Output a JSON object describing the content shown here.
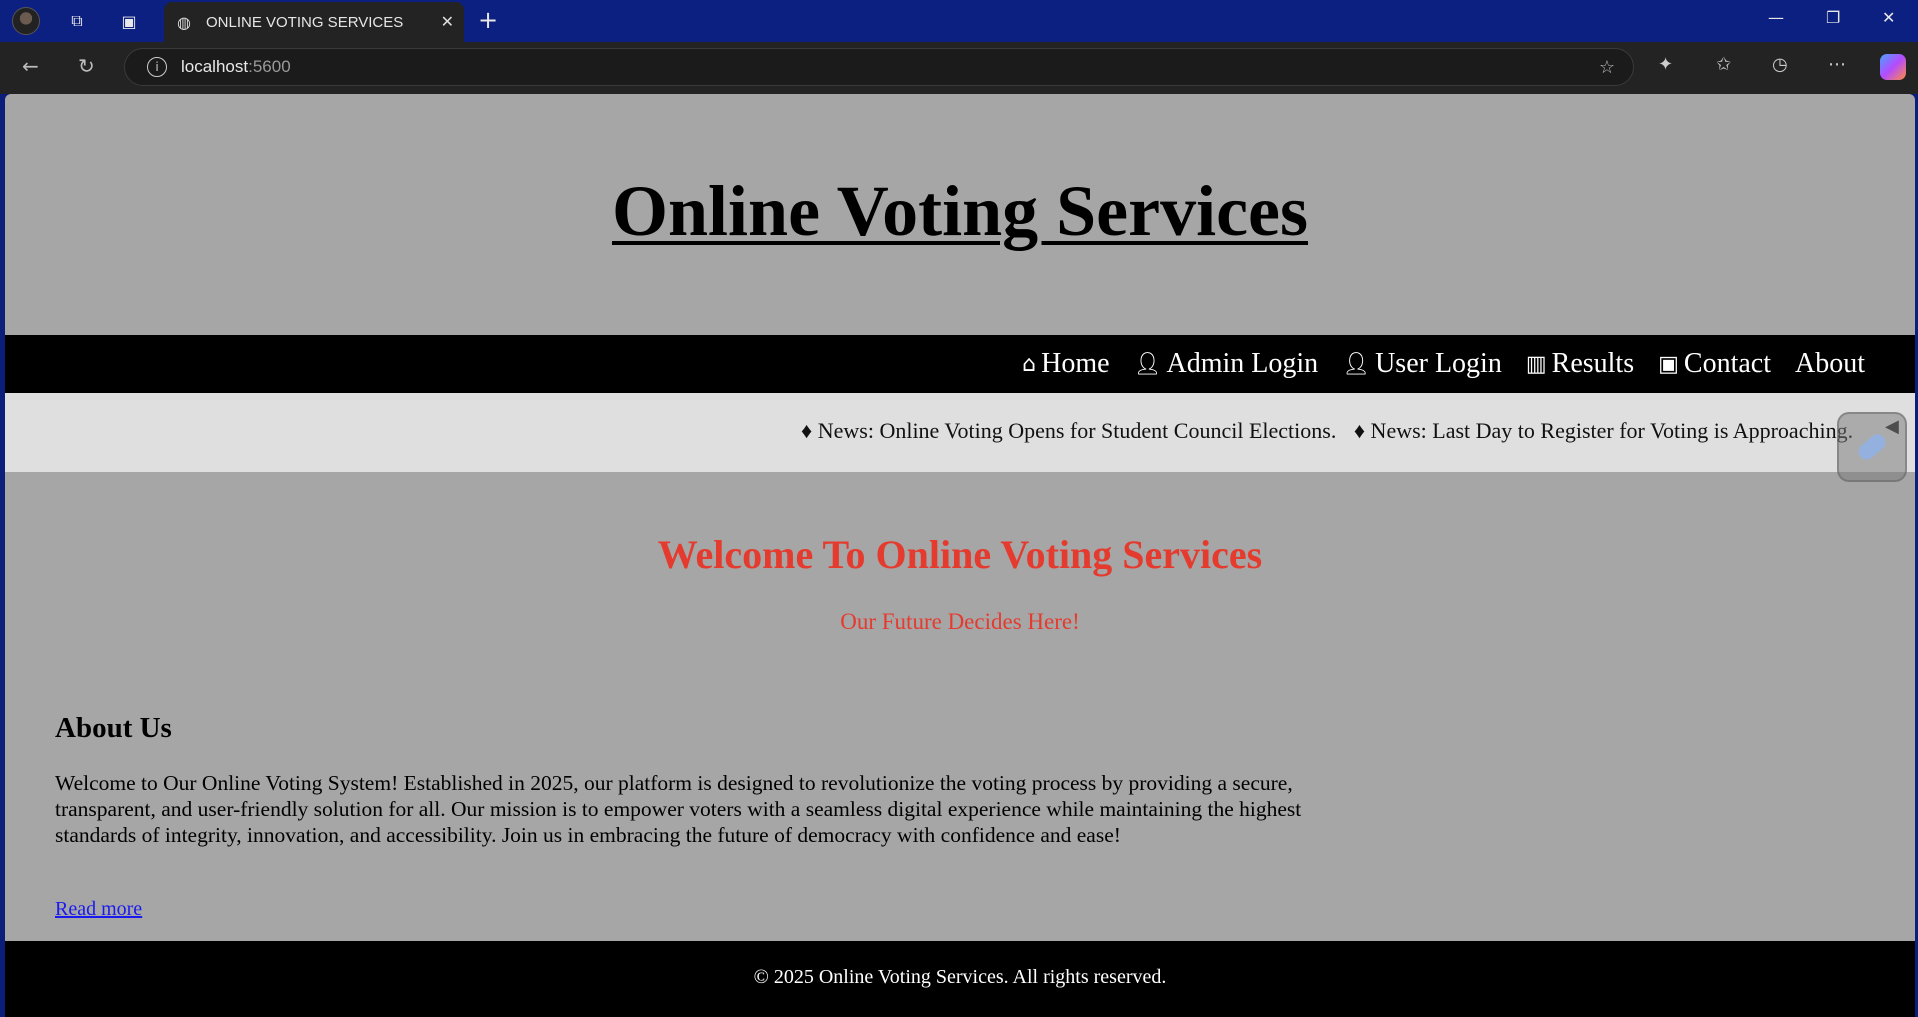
{
  "browser": {
    "tab_title": "ONLINE VOTING SERVICES",
    "url_host": "localhost",
    "url_port": ":5600"
  },
  "site": {
    "title": "Online Voting Services",
    "nav": [
      {
        "label": "Home",
        "icon": "home-icon"
      },
      {
        "label": "Admin Login",
        "icon": "user-icon"
      },
      {
        "label": "User Login",
        "icon": "user-icon"
      },
      {
        "label": "Results",
        "icon": "bar-chart-icon"
      },
      {
        "label": "Contact",
        "icon": "contact-card-icon"
      },
      {
        "label": "About",
        "icon": ""
      }
    ],
    "news": [
      "♦ News: Online Voting Opens for Student Council Elections.",
      "♦ News: Last Day to Register for Voting is Approaching."
    ],
    "welcome_heading": "Welcome To Online Voting Services",
    "tagline": "Our Future Decides Here!",
    "about": {
      "title": "About Us",
      "text": "Welcome to Our Online Voting System! Established in 2025, our platform is designed to revolutionize the voting process by providing a secure, transparent, and user-friendly solution for all. Our mission is to empower voters with a seamless digital experience while maintaining the highest standards of integrity, innovation, and accessibility. Join us in embracing the future of democracy with confidence and ease!",
      "link": "Read more"
    },
    "footer": "© 2025 Online Voting Services. All rights reserved."
  },
  "colors": {
    "page_bg": "#a6a6a6",
    "nav_bg": "#000000",
    "news_bg": "#e0dfdf",
    "accent_red": "#e53b2e",
    "link_blue": "#1a1aee"
  }
}
